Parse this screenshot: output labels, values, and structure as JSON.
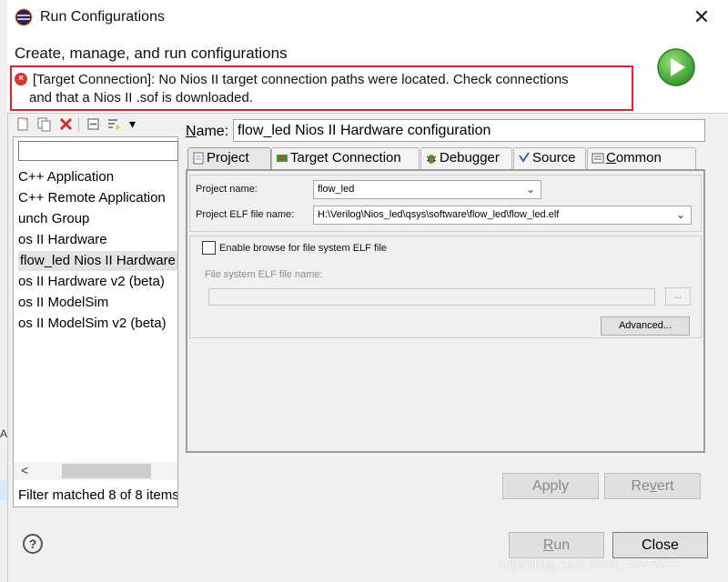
{
  "window": {
    "title": "Run Configurations",
    "close_symbol": "✕"
  },
  "banner": {
    "title": "Create, manage, and run configurations",
    "error_line1": "[Target Connection]: No Nios II target connection paths were located. Check connections",
    "error_line2": "and that a Nios II .sof is downloaded.",
    "error_symbol": "×"
  },
  "toolbar": {
    "icons": [
      "new-config-icon",
      "duplicate-icon",
      "delete-icon",
      "collapse-all-icon",
      "filter-icon",
      "dropdown-icon"
    ],
    "dropdown_symbol": "▾"
  },
  "sidebar": {
    "filter_value": "",
    "items": [
      "C++ Application",
      "C++ Remote Application",
      "unch Group",
      "os II Hardware",
      "flow_led Nios II Hardware configuration",
      "os II Hardware v2 (beta)",
      "os II ModelSim",
      "os II ModelSim v2 (beta)"
    ],
    "selected_index": 4,
    "scroll_left_symbol": "<",
    "filter_status": "Filter matched 8 of 8 items"
  },
  "config": {
    "name_label": "Name:",
    "name_value": "flow_led Nios II Hardware configuration",
    "tabs": [
      "Project",
      "Target Connection",
      "Debugger",
      "Source",
      "Common"
    ],
    "active_tab": 0,
    "project": {
      "project_name_label": "Project name:",
      "project_name_value": "flow_led",
      "elf_label": "Project ELF file name:",
      "elf_value": "H:\\Verilog\\Nios_led\\qsys\\software\\flow_led\\flow_led.elf",
      "enable_browse_label": "Enable browse for file system ELF file",
      "enable_browse_checked": false,
      "fs_elf_label": "File system ELF file name:",
      "fs_elf_value": "",
      "browse_label": "...",
      "advanced_label": "Advanced..."
    },
    "apply_label": "Apply",
    "revert_label": "Revert"
  },
  "footer": {
    "help_symbol": "?",
    "run_label": "Run",
    "close_label": "Close"
  },
  "watermark": "https://blog.csdn.net/qq_43279579",
  "left_edge_mark": "A:",
  "colors": {
    "error_border": "#e2222b",
    "run_green": "#3fae3a",
    "window_bg": "#f0f0f0"
  }
}
